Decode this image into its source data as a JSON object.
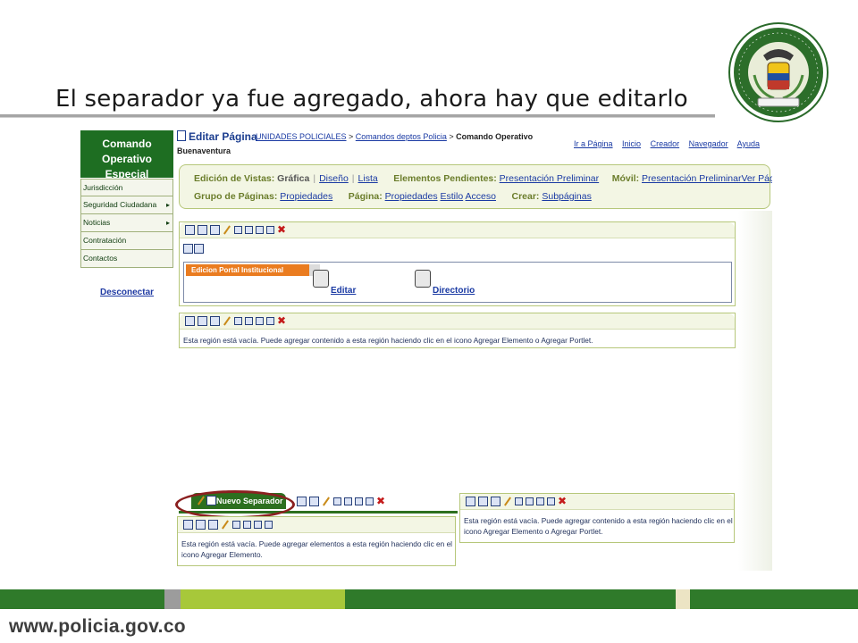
{
  "slide": {
    "title": "El separador ya fue agregado, ahora hay que editarlo",
    "footer_url": "www.policia.gov.co",
    "seal_icon": "policia-nacional-seal-icon",
    "colors": {
      "green_dark": "#2f7a2a",
      "green_light": "#a7c83a",
      "gray": "#9c9c9c",
      "cream": "#ece4c4"
    }
  },
  "nav": {
    "header": [
      "Comando Operativo",
      "Especial"
    ],
    "items": [
      {
        "label": "Jurisdicción",
        "arrow": ""
      },
      {
        "label": "Seguridad Ciudadana",
        "arrow": "▸"
      },
      {
        "label": "Noticias",
        "arrow": "▸"
      },
      {
        "label": "Contratación",
        "arrow": ""
      },
      {
        "label": "Contactos",
        "arrow": ""
      }
    ],
    "logout": "Desconectar"
  },
  "page": {
    "edit_title": "Editar Página",
    "breadcrumb": {
      "link1": "UNIDADES POLICIALES",
      "sep1": " > ",
      "link2": "Comandos deptos Policia",
      "sep2": " > ",
      "current": "Comando Operativo",
      "current_line2": "Buenaventura"
    },
    "toplinks": [
      "Ir a Página",
      "Inicio",
      "Creador",
      "Navegador",
      "Ayuda"
    ]
  },
  "toolbar": {
    "vistas_label": "Edición de Vistas:",
    "vistas_selected": "Gráfica",
    "vistas_diseno": "Diseño",
    "vistas_lista": "Lista",
    "pendientes_label": "Elementos Pendientes:",
    "pendientes_link": "Presentación Preliminar",
    "movil_label": "Móvil:",
    "movil_link1": "Presentación Preliminar",
    "movil_link2": "Ver Página",
    "grupo_label": "Grupo de Páginas:",
    "grupo_link": "Propiedades",
    "pagina_label": "Página:",
    "pagina_props": "Propiedades",
    "pagina_estilo": "Estilo",
    "pagina_acceso": "Acceso",
    "crear_label": "Crear:",
    "crear_link": "Subpáginas"
  },
  "portal": {
    "tab_label": "Edicion Portal Institucional",
    "editar": "Editar",
    "directorio": "Directorio"
  },
  "regions": {
    "empty_portlet": "Esta región está vacía. Puede agregar contenido a esta región haciendo clic en el icono Agregar Elemento o Agregar Portlet.",
    "empty_right_l1": "Esta región está vacía. Puede agregar contenido a esta región haciendo clic en el",
    "empty_right_l2": "icono Agregar Elemento o Agregar Portlet.",
    "empty_left_l1": "Esta región está vacía. Puede agregar elementos a esta región haciendo clic en el",
    "empty_left_l2": "icono Agregar Elemento."
  },
  "separator": {
    "tab_label": "Nuevo Separador"
  }
}
